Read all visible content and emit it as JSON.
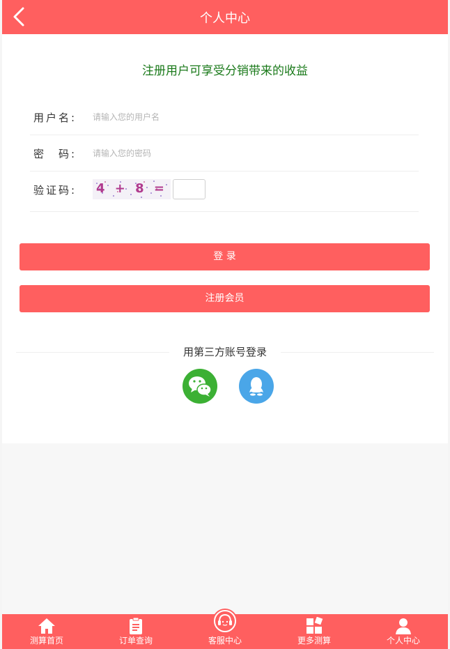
{
  "header": {
    "title": "个人中心",
    "back_icon": "chevron-left-icon"
  },
  "promo_text": "注册用户可享受分销带来的收益",
  "form": {
    "username": {
      "label": "用户名:",
      "placeholder": "请输入您的用户名",
      "value": ""
    },
    "password": {
      "label": "密　码:",
      "placeholder": "请输入您的密码",
      "value": ""
    },
    "captcha": {
      "label": "验证码:",
      "image_text": "4 + 8 =",
      "value": ""
    }
  },
  "buttons": {
    "login": "登 录",
    "register": "注册会员"
  },
  "third_party": {
    "title": "用第三方账号登录",
    "wechat_icon": "wechat-icon",
    "qq_icon": "qq-icon"
  },
  "bottom_nav": [
    {
      "label": "测算首页",
      "icon": "home-icon"
    },
    {
      "label": "订单查询",
      "icon": "clipboard-icon"
    },
    {
      "label": "客服中心",
      "icon": "headset-icon"
    },
    {
      "label": "更多测算",
      "icon": "grid-icon"
    },
    {
      "label": "个人中心",
      "icon": "user-icon"
    }
  ],
  "colors": {
    "brand": "#ff5f5f",
    "promo": "#1b7a1b",
    "wechat": "#3cb034",
    "qq": "#4aa6e8"
  }
}
